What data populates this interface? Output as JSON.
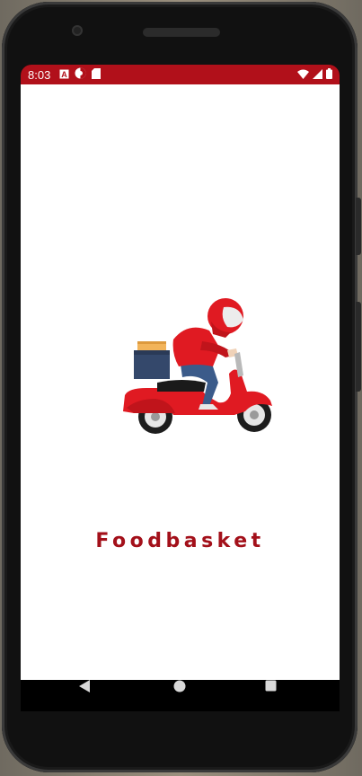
{
  "status_bar": {
    "time": "8:03",
    "background_color": "#b1101a",
    "left_icons": [
      "a-icon",
      "circle-half-icon",
      "sd-card-icon"
    ],
    "right_icons": [
      "wifi-icon",
      "signal-icon",
      "battery-icon"
    ]
  },
  "splash": {
    "title": "Foodbasket",
    "title_color": "#a3101a",
    "illustration": "delivery-scooter-rider"
  },
  "nav_bar": {
    "buttons": [
      "back",
      "home",
      "recents"
    ]
  }
}
